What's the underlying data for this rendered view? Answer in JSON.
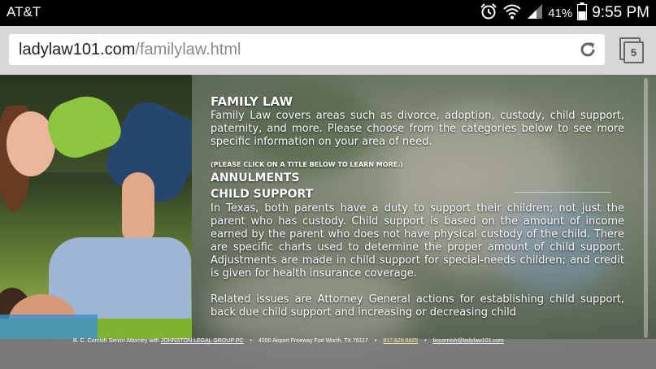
{
  "status_bar": {
    "carrier": "AT&T",
    "battery_percent": "41%",
    "time": "9:55 PM",
    "icons": [
      "alarm-icon",
      "wifi-icon",
      "signal-icon",
      "battery-icon"
    ]
  },
  "browser": {
    "url_domain": "ladylaw101.com",
    "url_path": "/familylaw.html",
    "tab_count": "5"
  },
  "page": {
    "title": "FAMILY LAW",
    "intro": "Family Law covers areas such as divorce, adoption, custody, child support, paternity, and more. Please choose from the categories below to see more specific information on your area of need.",
    "click_note": "(PLEASE CLICK ON A TITLE BELOW TO LEARN MORE.)",
    "section_links": [
      "ANNULMENTS",
      "CHILD SUPPORT"
    ],
    "child_support_text": "In Texas, both parents have a duty to support their children; not just the parent who has custody. Child support is based on the amount of income earned by the parent who does not have physical custody of the child. There are specific charts used to determine the proper amount of child support. Adjustments are made in child support for special-needs children; and credit is given for health insurance coverage.",
    "related_text": "Related issues are Attorney General actions for establishing child support, back due child support and increasing or decreasing child"
  },
  "footer": {
    "attorney": "B. C. Cornish Senior Attorney with",
    "firm": "JOHNSTON LEGAL GROUP PC",
    "address": "4200 Airport Freeway Fort Worth, TX 76117",
    "phone": "817.820.0825",
    "email": "bccornish@ladylaw101.com",
    "separator": "•"
  }
}
